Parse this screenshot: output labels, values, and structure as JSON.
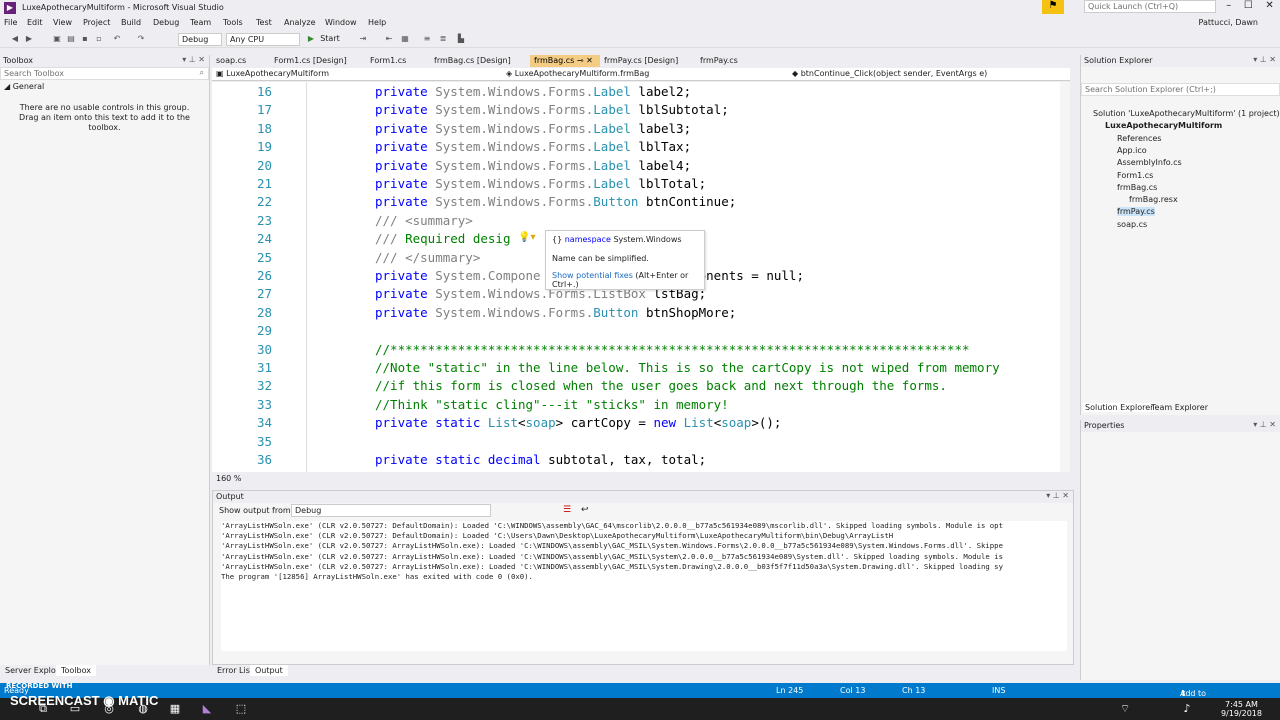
{
  "window": {
    "title": "LuxeApothecaryMultiform - Microsoft Visual Studio",
    "notification_icon": "flag-icon",
    "quick_launch_placeholder": "Quick Launch (Ctrl+Q)",
    "user": "Pattucci, Dawn"
  },
  "menu": [
    "File",
    "Edit",
    "View",
    "Project",
    "Build",
    "Debug",
    "Team",
    "Tools",
    "Test",
    "Analyze",
    "Window",
    "Help"
  ],
  "toolbar": {
    "config": "Debug",
    "platform": "Any CPU",
    "start_label": "Start"
  },
  "toolbox": {
    "title": "Toolbox",
    "search_placeholder": "Search Toolbox",
    "group": "General",
    "empty_message": "There are no usable controls in this group. Drag an item onto this text to add it to the toolbox."
  },
  "tabs": [
    {
      "label": "soap.cs",
      "active": false
    },
    {
      "label": "Form1.cs [Design]",
      "active": false
    },
    {
      "label": "Form1.cs",
      "active": false
    },
    {
      "label": "frmBag.cs [Design]",
      "active": false
    },
    {
      "label": "frmBag.cs",
      "active": true
    },
    {
      "label": "frmPay.cs [Design]",
      "active": false
    },
    {
      "label": "frmPay.cs",
      "active": false
    }
  ],
  "nav": {
    "project": "LuxeApothecaryMultiform",
    "class": "LuxeApothecaryMultiform.frmBag",
    "member": "btnContinue_Click(object sender, EventArgs e)"
  },
  "code": [
    {
      "n": "16",
      "parts": [
        [
          "kw",
          "private "
        ],
        [
          "typ",
          "System.Windows.Forms."
        ],
        [
          "cls",
          "Label"
        ],
        [
          "ident",
          " label2;"
        ]
      ]
    },
    {
      "n": "17",
      "parts": [
        [
          "kw",
          "private "
        ],
        [
          "typ",
          "System.Windows.Forms."
        ],
        [
          "cls",
          "Label"
        ],
        [
          "ident",
          " lblSubtotal;"
        ]
      ]
    },
    {
      "n": "18",
      "parts": [
        [
          "kw",
          "private "
        ],
        [
          "typ",
          "System.Windows.Forms."
        ],
        [
          "cls",
          "Label"
        ],
        [
          "ident",
          " label3;"
        ]
      ]
    },
    {
      "n": "19",
      "parts": [
        [
          "kw",
          "private "
        ],
        [
          "typ",
          "System.Windows.Forms."
        ],
        [
          "cls",
          "Label"
        ],
        [
          "ident",
          " lblTax;"
        ]
      ]
    },
    {
      "n": "20",
      "parts": [
        [
          "kw",
          "private "
        ],
        [
          "typ",
          "System.Windows.Forms."
        ],
        [
          "cls",
          "Label"
        ],
        [
          "ident",
          " label4;"
        ]
      ]
    },
    {
      "n": "21",
      "parts": [
        [
          "kw",
          "private "
        ],
        [
          "typ",
          "System.Windows.Forms."
        ],
        [
          "cls",
          "Label"
        ],
        [
          "ident",
          " lblTotal;"
        ]
      ]
    },
    {
      "n": "22",
      "parts": [
        [
          "kw",
          "private "
        ],
        [
          "typ",
          "System.Windows.Forms."
        ],
        [
          "cls",
          "Button"
        ],
        [
          "ident",
          " btnContinue;"
        ]
      ]
    },
    {
      "n": "23",
      "parts": [
        [
          "typ",
          "/// <summary>"
        ]
      ]
    },
    {
      "n": "24",
      "parts": [
        [
          "typ",
          "/// "
        ],
        [
          "cmt",
          "Required desig"
        ]
      ]
    },
    {
      "n": "25",
      "parts": [
        [
          "typ",
          "/// </summary>"
        ]
      ]
    },
    {
      "n": "26",
      "parts": [
        [
          "kw",
          "private "
        ],
        [
          "typ",
          "System.Compone"
        ],
        [
          "ident",
          "                   nponents = null;"
        ]
      ]
    },
    {
      "n": "27",
      "parts": [
        [
          "kw",
          "private "
        ],
        [
          "typ",
          "System.Windows.Forms.ListBox"
        ],
        [
          "ident",
          " lstBag;"
        ]
      ]
    },
    {
      "n": "28",
      "parts": [
        [
          "kw",
          "private "
        ],
        [
          "typ",
          "System.Windows.Forms."
        ],
        [
          "cls",
          "Button"
        ],
        [
          "ident",
          " btnShopMore;"
        ]
      ]
    },
    {
      "n": "29",
      "parts": []
    },
    {
      "n": "30",
      "parts": [
        [
          "cmt",
          "//*****************************************************************************"
        ]
      ]
    },
    {
      "n": "31",
      "parts": [
        [
          "cmt",
          "//Note \"static\" in the line below. This is so the cartCopy is not wiped from memory"
        ]
      ]
    },
    {
      "n": "32",
      "parts": [
        [
          "cmt",
          "//if this form is closed when the user goes back and next through the forms."
        ]
      ]
    },
    {
      "n": "33",
      "parts": [
        [
          "cmt",
          "//Think \"static cling\"---it \"sticks\" in memory!"
        ]
      ]
    },
    {
      "n": "34",
      "parts": [
        [
          "kw",
          "private static "
        ],
        [
          "cls",
          "List"
        ],
        [
          "ident",
          "<"
        ],
        [
          "cls",
          "soap"
        ],
        [
          "ident",
          "> cartCopy = "
        ],
        [
          "kw",
          "new "
        ],
        [
          "cls",
          "List"
        ],
        [
          "ident",
          "<"
        ],
        [
          "cls",
          "soap"
        ],
        [
          "ident",
          ">();"
        ]
      ]
    },
    {
      "n": "35",
      "parts": []
    },
    {
      "n": "36",
      "parts": [
        [
          "kw",
          "private static decimal"
        ],
        [
          "ident",
          " subtotal, tax, total;"
        ]
      ]
    }
  ],
  "tooltip": {
    "namespace_kw": "namespace",
    "namespace_name": "System.Windows",
    "message": "Name can be simplified.",
    "fix_link": "Show potential fixes",
    "fix_shortcut": "(Alt+Enter or Ctrl+.)"
  },
  "zoom": "160 %",
  "solution_explorer": {
    "title": "Solution Explorer",
    "search_placeholder": "Search Solution Explorer (Ctrl+;)",
    "items": [
      {
        "label": "Solution 'LuxeApothecaryMultiform' (1 project)",
        "indent": 0,
        "bold": false,
        "selected": false
      },
      {
        "label": "LuxeApothecaryMultiform",
        "indent": 1,
        "bold": true,
        "selected": false
      },
      {
        "label": "References",
        "indent": 2,
        "bold": false,
        "selected": false
      },
      {
        "label": "App.ico",
        "indent": 2,
        "bold": false,
        "selected": false
      },
      {
        "label": "AssemblyInfo.cs",
        "indent": 2,
        "bold": false,
        "selected": false
      },
      {
        "label": "Form1.cs",
        "indent": 2,
        "bold": false,
        "selected": false
      },
      {
        "label": "frmBag.cs",
        "indent": 2,
        "bold": false,
        "selected": false
      },
      {
        "label": "frmBag.resx",
        "indent": 3,
        "bold": false,
        "selected": false
      },
      {
        "label": "frmPay.cs",
        "indent": 2,
        "bold": false,
        "selected": true
      },
      {
        "label": "soap.cs",
        "indent": 2,
        "bold": false,
        "selected": false
      }
    ],
    "tab1": "Solution Explorer",
    "tab2": "Team Explorer"
  },
  "properties": {
    "title": "Properties"
  },
  "output": {
    "title": "Output",
    "show_from_label": "Show output from:",
    "show_from_value": "Debug",
    "lines": [
      "'ArrayListHWSoln.exe' (CLR v2.0.50727: DefaultDomain): Loaded 'C:\\WINDOWS\\assembly\\GAC_64\\mscorlib\\2.0.0.0__b77a5c561934e089\\mscorlib.dll'. Skipped loading symbols. Module is opt",
      "'ArrayListHWSoln.exe' (CLR v2.0.50727: DefaultDomain): Loaded 'C:\\Users\\Dawn\\Desktop\\LuxeApothecaryMultiform\\LuxeApothecaryMultiform\\bin\\Debug\\ArrayListH",
      "'ArrayListHWSoln.exe' (CLR v2.0.50727: ArrayListHWSoln.exe): Loaded 'C:\\WINDOWS\\assembly\\GAC_MSIL\\System.Windows.Forms\\2.0.0.0__b77a5c561934e089\\System.Windows.Forms.dll'. Skippe",
      "'ArrayListHWSoln.exe' (CLR v2.0.50727: ArrayListHWSoln.exe): Loaded 'C:\\WINDOWS\\assembly\\GAC_MSIL\\System\\2.0.0.0__b77a5c561934e089\\System.dll'. Skipped loading symbols. Module is",
      "'ArrayListHWSoln.exe' (CLR v2.0.50727: ArrayListHWSoln.exe): Loaded 'C:\\WINDOWS\\assembly\\GAC_MSIL\\System.Drawing\\2.0.0.0__b03f5f7f11d50a3a\\System.Drawing.dll'. Skipped loading sy",
      "The program '[12856] ArrayListHWSoln.exe' has exited with code 0 (0x0)."
    ]
  },
  "bottom_tabs": [
    "Error List",
    "Output"
  ],
  "left_bottom_tabs": [
    "Server Explorer",
    "Toolbox"
  ],
  "status": {
    "left": "Ready",
    "ln": "Ln 245",
    "col": "Col 13",
    "ch": "Ch 13",
    "ins": "INS",
    "source_control": "Add to Source Control"
  },
  "taskbar": {
    "recorded_with": "RECORDED WITH",
    "brand": "SCREENCAST",
    "brand2": "MATIC",
    "time": "7:45 AM",
    "date": "9/19/2018"
  },
  "colors": {
    "accent": "#007acc",
    "active_tab": "#f5cc84",
    "keyword": "#0000ff",
    "type": "#2b91af",
    "comment": "#008000"
  }
}
